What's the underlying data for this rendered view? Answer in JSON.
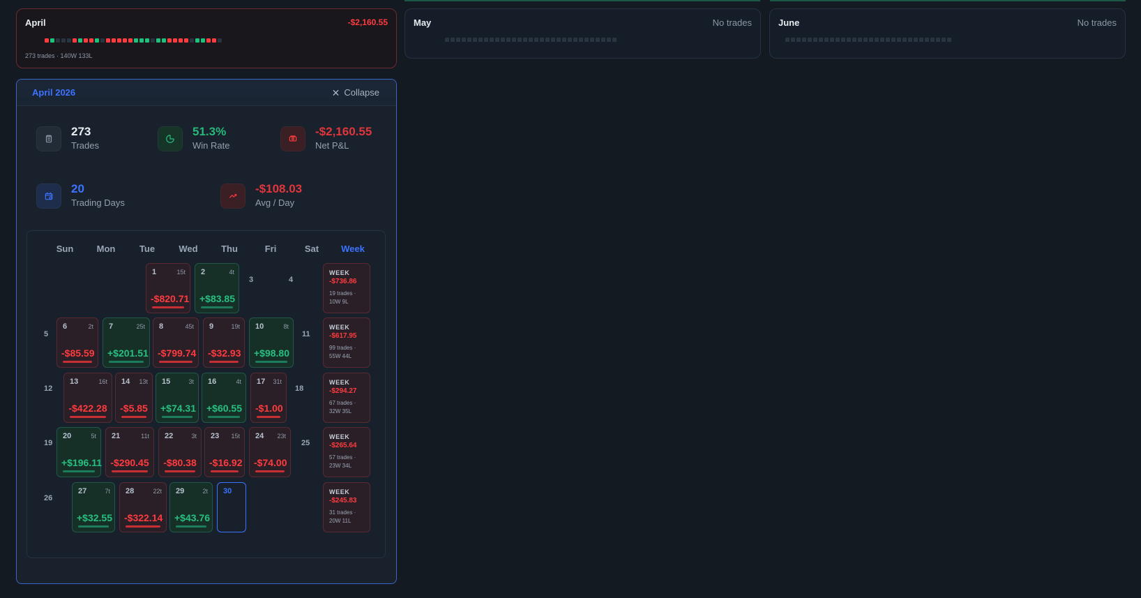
{
  "months": {
    "april": {
      "name": "April",
      "net": "-$2,160.55",
      "subtitle": "273 trades · 140W 133L",
      "squares": [
        "r",
        "g",
        "n",
        "n",
        "n",
        "r",
        "g",
        "r",
        "r",
        "g",
        "n",
        "r",
        "r",
        "r",
        "r",
        "r",
        "g",
        "g",
        "g",
        "n",
        "g",
        "g",
        "r",
        "r",
        "r",
        "r",
        "n",
        "g",
        "g",
        "r",
        "r",
        "n"
      ]
    },
    "may": {
      "name": "May",
      "status": "No trades",
      "squares_count": 31
    },
    "june": {
      "name": "June",
      "status": "No trades",
      "squares_count": 30
    }
  },
  "expanded": {
    "title": "April 2026",
    "collapse_label": "Collapse",
    "stats": {
      "trades": {
        "value": "273",
        "label": "Trades"
      },
      "win_rate": {
        "value": "51.3%",
        "label": "Win Rate"
      },
      "net_pnl": {
        "value": "-$2,160.55",
        "label": "Net P&L"
      },
      "trading_days": {
        "value": "20",
        "label": "Trading Days"
      },
      "avg_day": {
        "value": "-$108.03",
        "label": "Avg / Day"
      }
    },
    "calendar": {
      "dow": [
        "Sun",
        "Mon",
        "Tue",
        "Wed",
        "Thu",
        "Fri",
        "Sat",
        "Week"
      ],
      "week_label": "WEEK",
      "days": {
        "1": {
          "trades": "15t",
          "pnl": "-$820.71",
          "type": "red"
        },
        "2": {
          "trades": "4t",
          "pnl": "+$83.85",
          "type": "green"
        },
        "6": {
          "trades": "2t",
          "pnl": "-$85.59",
          "type": "red"
        },
        "7": {
          "trades": "25t",
          "pnl": "+$201.51",
          "type": "green"
        },
        "8": {
          "trades": "45t",
          "pnl": "-$799.74",
          "type": "red"
        },
        "9": {
          "trades": "19t",
          "pnl": "-$32.93",
          "type": "red"
        },
        "10": {
          "trades": "8t",
          "pnl": "+$98.80",
          "type": "green"
        },
        "13": {
          "trades": "16t",
          "pnl": "-$422.28",
          "type": "red"
        },
        "14": {
          "trades": "13t",
          "pnl": "-$5.85",
          "type": "red"
        },
        "15": {
          "trades": "3t",
          "pnl": "+$74.31",
          "type": "green"
        },
        "16": {
          "trades": "4t",
          "pnl": "+$60.55",
          "type": "green"
        },
        "17": {
          "trades": "31t",
          "pnl": "-$1.00",
          "type": "red"
        },
        "20": {
          "trades": "5t",
          "pnl": "+$196.11",
          "type": "green"
        },
        "21": {
          "trades": "11t",
          "pnl": "-$290.45",
          "type": "red"
        },
        "22": {
          "trades": "3t",
          "pnl": "-$80.38",
          "type": "red"
        },
        "23": {
          "trades": "15t",
          "pnl": "-$16.92",
          "type": "red"
        },
        "24": {
          "trades": "23t",
          "pnl": "-$74.00",
          "type": "red"
        },
        "27": {
          "trades": "7t",
          "pnl": "+$32.55",
          "type": "green"
        },
        "28": {
          "trades": "22t",
          "pnl": "-$322.14",
          "type": "red"
        },
        "29": {
          "trades": "2t",
          "pnl": "+$43.76",
          "type": "green"
        }
      },
      "plain_days": [
        "3",
        "4",
        "5",
        "11",
        "12",
        "18",
        "19",
        "25",
        "26"
      ],
      "today": "30",
      "weeks": [
        {
          "pnl": "-$736.86",
          "meta": "19 trades ·",
          "meta2": "10W 9L"
        },
        {
          "pnl": "-$617.95",
          "meta": "99 trades ·",
          "meta2": "55W 44L"
        },
        {
          "pnl": "-$294.27",
          "meta": "67 trades ·",
          "meta2": "32W 35L"
        },
        {
          "pnl": "-$265.64",
          "meta": "57 trades ·",
          "meta2": "23W 34L"
        },
        {
          "pnl": "-$245.83",
          "meta": "31 trades ·",
          "meta2": "20W 11L"
        }
      ]
    }
  },
  "colors": {
    "green": "#27b87a",
    "red": "#e0363b",
    "blue": "#3c73ff",
    "bg": "#131a22"
  },
  "icons": {
    "trades": "clipboard-icon",
    "win_rate": "pie-chart-icon",
    "net_pnl": "money-icon",
    "trading_days": "calendar-icon",
    "avg_day": "trending-up-icon",
    "collapse": "close-icon"
  }
}
